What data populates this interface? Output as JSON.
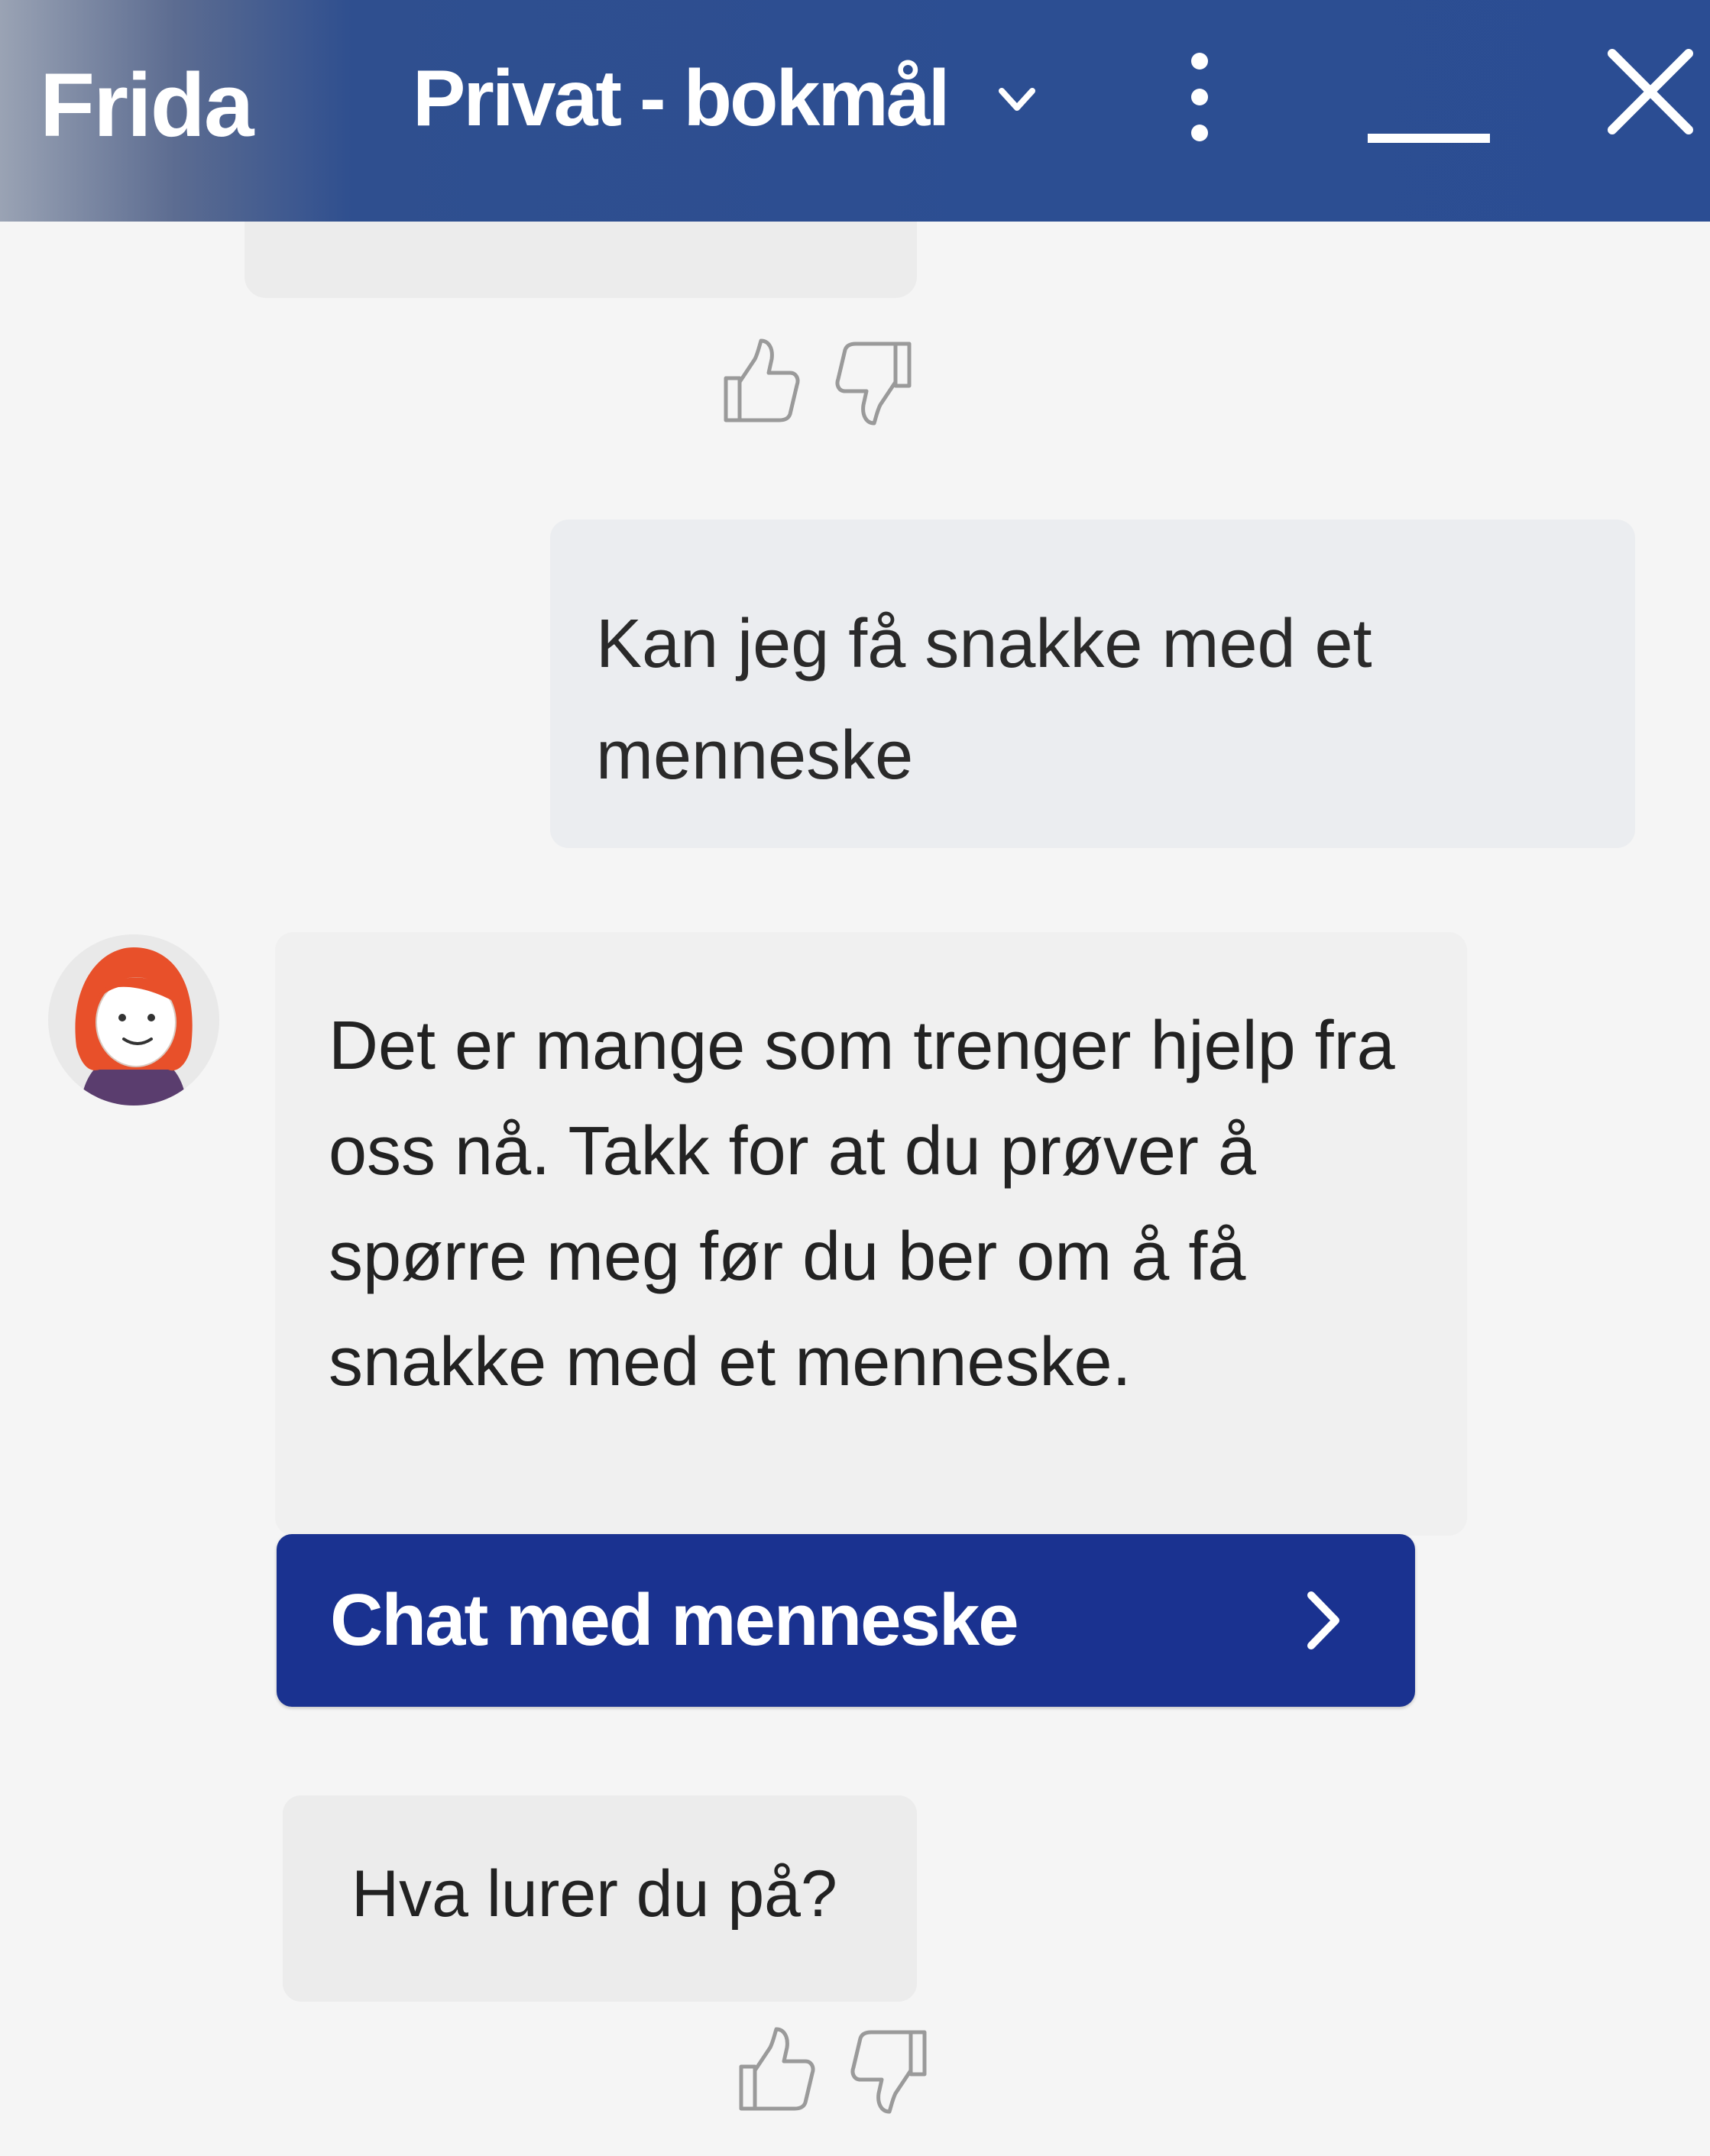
{
  "header": {
    "title": "Frida",
    "language_select": {
      "selected": "Privat - bokmål"
    },
    "icons": {
      "chevron": "chevron-down-icon",
      "menu": "more-vertical-icon",
      "minimize": "minimize-icon",
      "close": "close-icon"
    },
    "colors": {
      "header_bg": "#2c4e92",
      "header_text": "#ffffff"
    }
  },
  "messages": [
    {
      "from": "user",
      "text": "Kan jeg få snakke med et menneske"
    },
    {
      "from": "bot",
      "avatar": "frida-avatar",
      "text": "Det er mange som trenger hjelp fra oss nå. Takk for at du prøver å spørre meg før du ber om å få snakke med et menneske.",
      "action_button": {
        "label": "Chat med menneske",
        "icon": "chevron-right-icon"
      }
    },
    {
      "from": "bot",
      "text": "Hva lurer du på?"
    }
  ],
  "feedback": {
    "thumbs_up_icon": "thumbs-up-icon",
    "thumbs_down_icon": "thumbs-down-icon"
  },
  "colors": {
    "cta_bg": "#1a3290",
    "bubble_bg": "#ececec",
    "text": "#222222"
  }
}
